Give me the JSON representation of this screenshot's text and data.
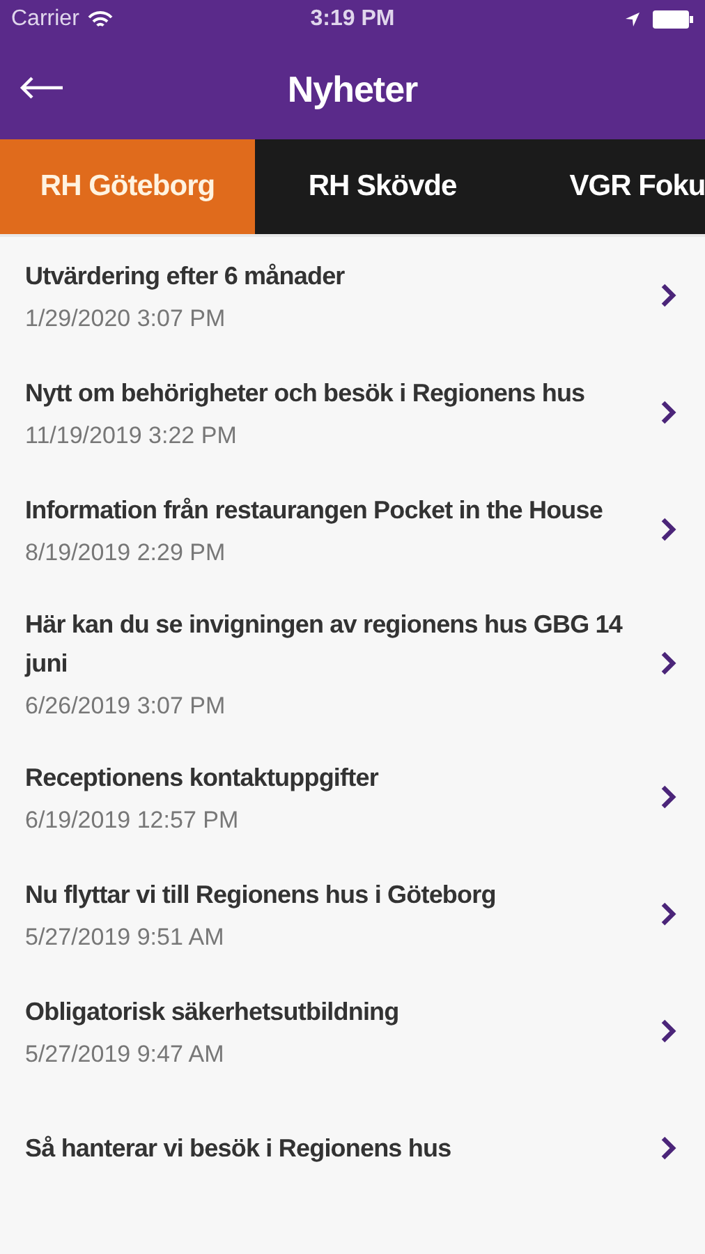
{
  "status_bar": {
    "carrier": "Carrier",
    "time": "3:19 PM"
  },
  "nav": {
    "title": "Nyheter"
  },
  "tabs": [
    {
      "label": "RH Göteborg",
      "selected": true
    },
    {
      "label": "RH Skövde",
      "selected": false
    },
    {
      "label": "VGR Foku",
      "selected": false
    }
  ],
  "news": [
    {
      "title": "Utvärdering efter 6 månader",
      "date": "1/29/2020 3:07 PM"
    },
    {
      "title": "Nytt om behörigheter och besök i Regionens hus",
      "date": "11/19/2019 3:22 PM"
    },
    {
      "title": "Information från restaurangen Pocket in the House",
      "date": "8/19/2019 2:29 PM"
    },
    {
      "title": "Här kan du se invigningen av regionens hus GBG 14 juni",
      "date": "6/26/2019 3:07 PM"
    },
    {
      "title": "Receptionens kontaktuppgifter",
      "date": "6/19/2019 12:57 PM"
    },
    {
      "title": "Nu flyttar vi till Regionens hus i Göteborg",
      "date": "5/27/2019 9:51 AM"
    },
    {
      "title": "Obligatorisk säkerhetsutbildning",
      "date": "5/27/2019 9:47 AM"
    },
    {
      "title": "Så hanterar vi besök i Regionens hus"
    }
  ]
}
